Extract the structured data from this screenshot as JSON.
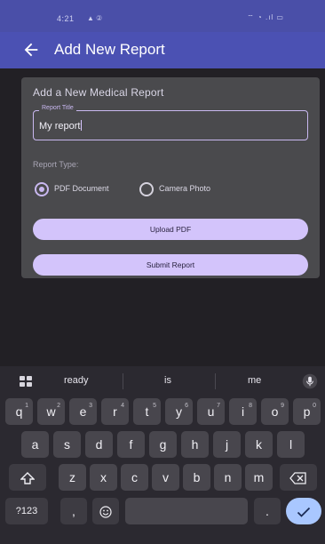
{
  "status_bar": {
    "time": "4:21",
    "left_icons": "▲ ②",
    "right_icons": "⌔ ◔ .ıl ▭"
  },
  "app_bar": {
    "back_icon": "arrow-left-icon",
    "title": "Add New Report"
  },
  "form": {
    "card_title": "Add a New Medical Report",
    "report_title_label": "Report Title",
    "report_title_value": "My report",
    "report_type_label": "Report Type:",
    "options": [
      {
        "label": "PDF Document",
        "selected": true
      },
      {
        "label": "Camera Photo",
        "selected": false
      }
    ],
    "upload_button": "Upload PDF",
    "submit_button": "Submit Report"
  },
  "keyboard": {
    "suggestions": [
      "ready",
      "is",
      "me"
    ],
    "row1": [
      "q",
      "w",
      "e",
      "r",
      "t",
      "y",
      "u",
      "i",
      "o",
      "p"
    ],
    "row1_hints": [
      "1",
      "2",
      "3",
      "4",
      "5",
      "6",
      "7",
      "8",
      "9",
      "0"
    ],
    "row2": [
      "a",
      "s",
      "d",
      "f",
      "g",
      "h",
      "j",
      "k",
      "l"
    ],
    "row3": [
      "z",
      "x",
      "c",
      "v",
      "b",
      "n",
      "m"
    ],
    "symbols_key": "?123",
    "comma_key": ",",
    "period_key": ".",
    "colors": {
      "enter": "#a9c7ff",
      "key": "#48464d"
    }
  },
  "colors": {
    "app_bar": "#4b51b3",
    "accent": "#c9b8f0",
    "button": "#d3c4fb"
  }
}
